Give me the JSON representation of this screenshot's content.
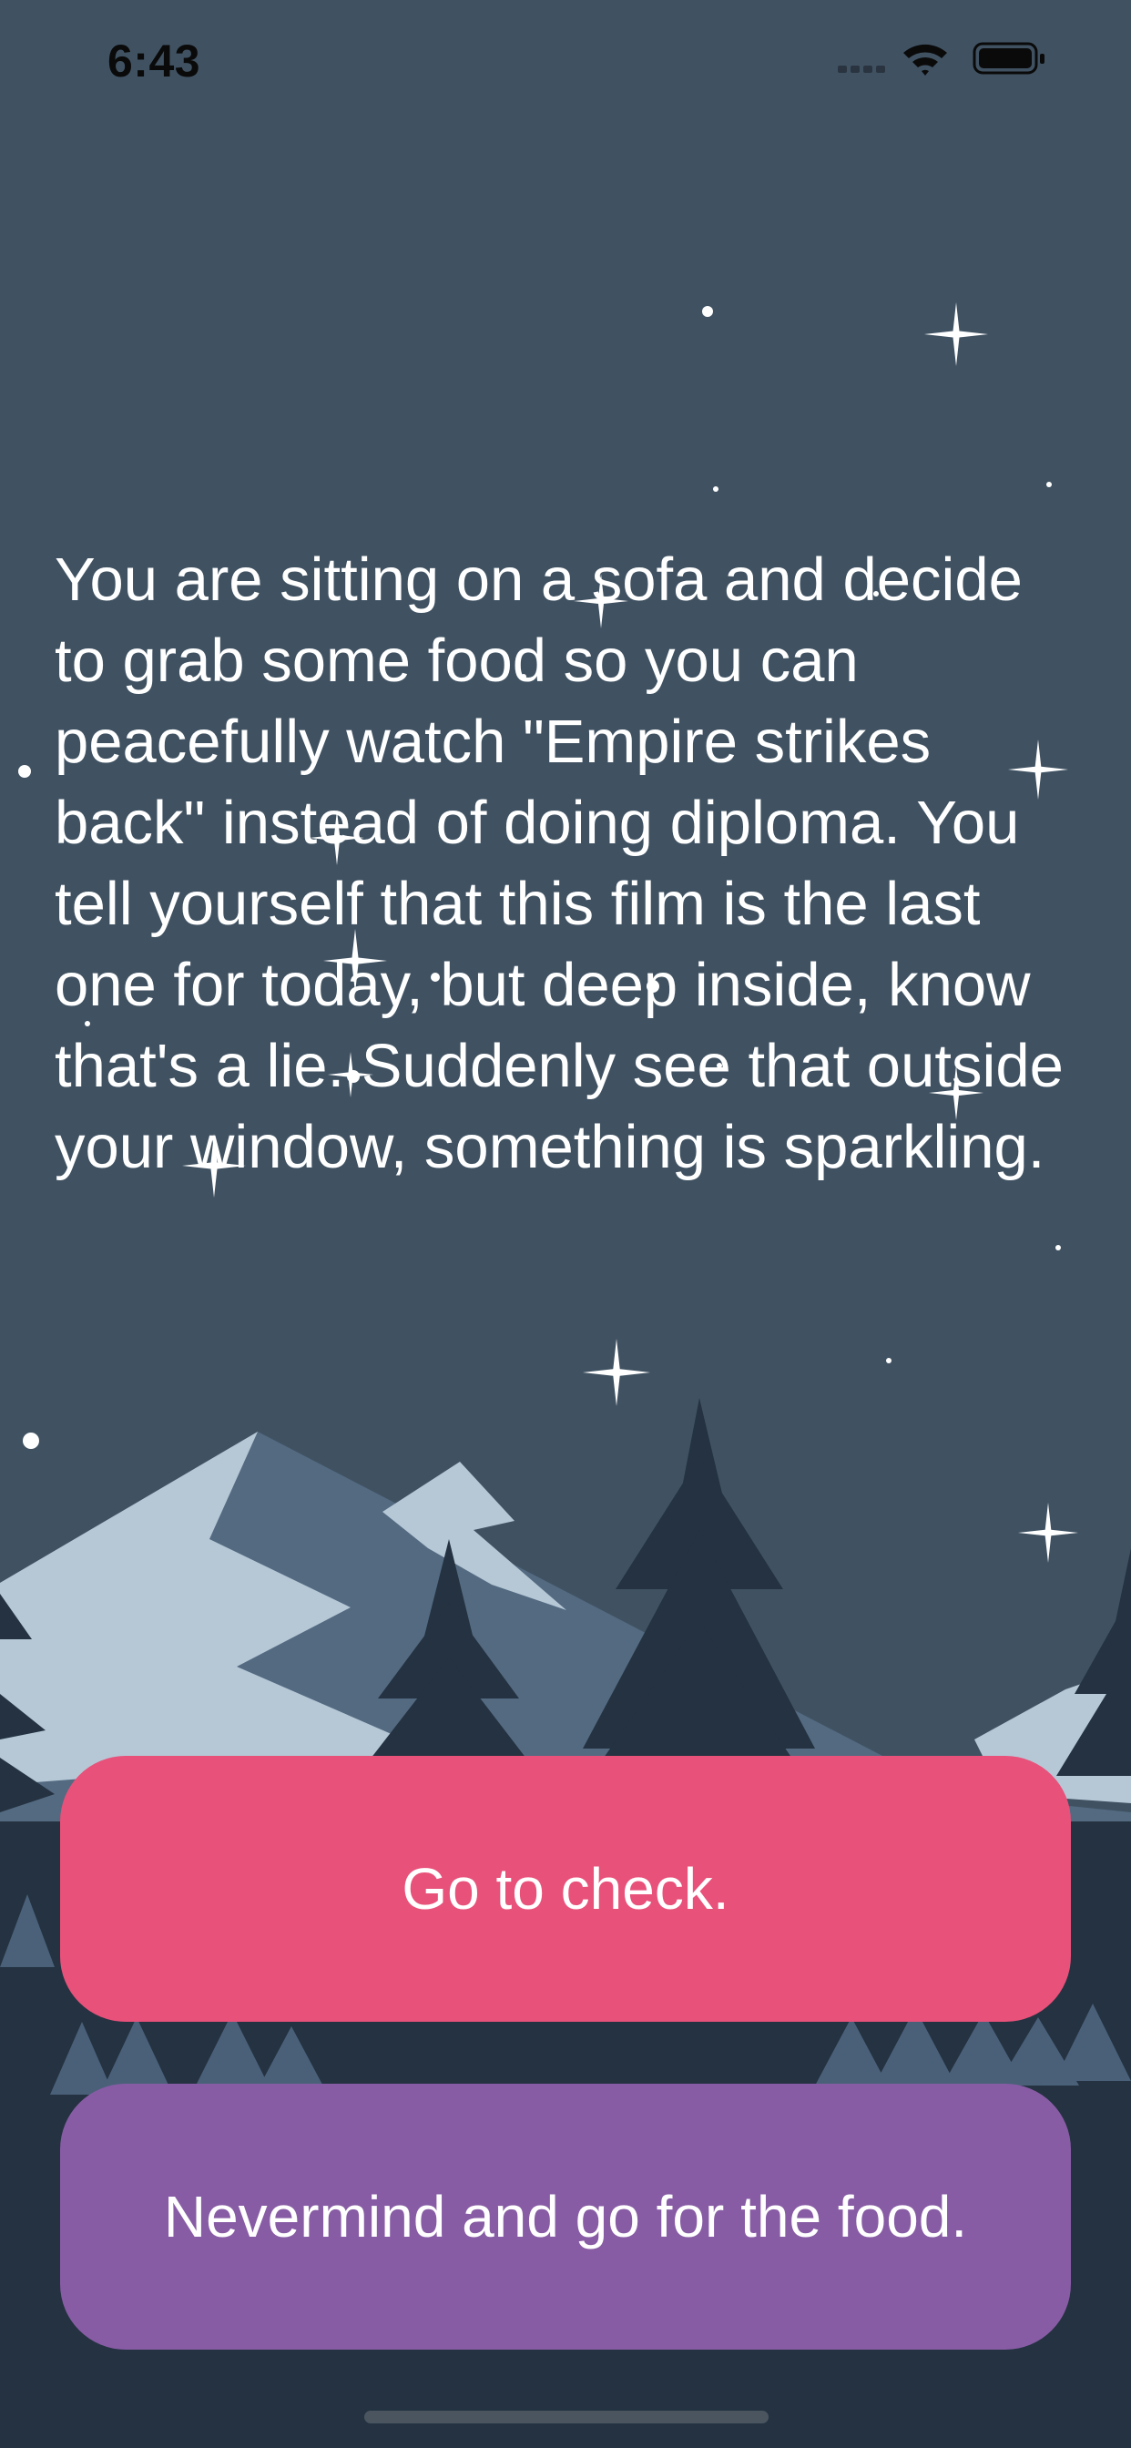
{
  "status_bar": {
    "time": "6:43"
  },
  "story": {
    "text": "You are sitting on a sofa and decide to grab some food so you can peacefully watch \"Empire strikes back\" instead of doing diploma. You tell yourself that this film is the last one for today, but deep inside, know that's a lie. Suddenly see that outside your window, something is sparkling."
  },
  "choices": [
    {
      "label": "Go to check."
    },
    {
      "label": "Nevermind and go for the food."
    }
  ],
  "colors": {
    "sky": "#405262",
    "choice_primary": "#e8517a",
    "choice_secondary": "#875ca4",
    "text": "#ffffff"
  },
  "icons": [
    "signal-icon",
    "wifi-icon",
    "battery-icon"
  ]
}
